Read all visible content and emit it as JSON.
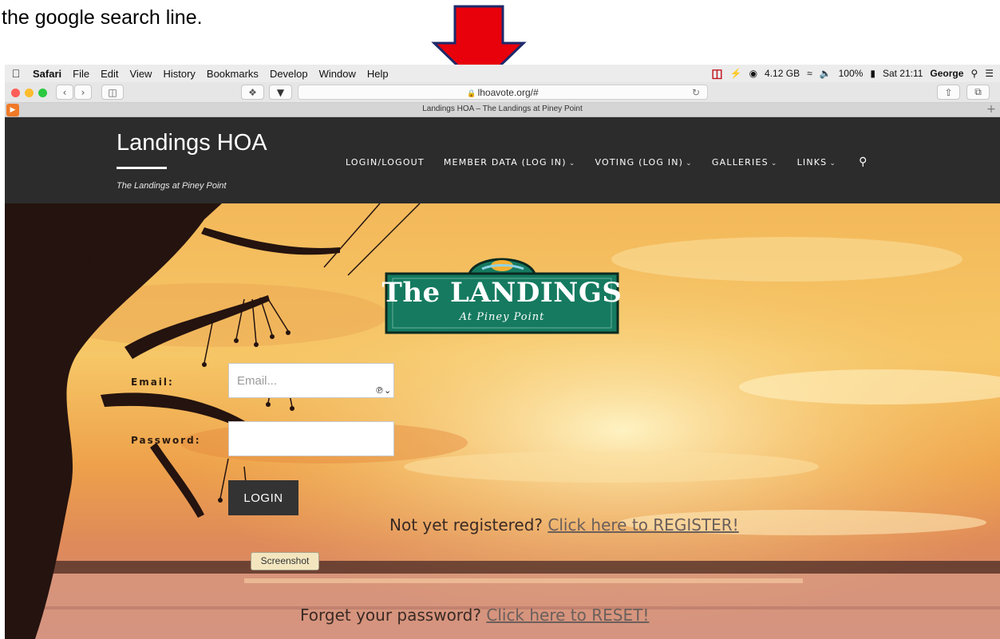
{
  "caption": "the google search line.",
  "menubar": {
    "app": "Safari",
    "items": [
      "File",
      "Edit",
      "View",
      "History",
      "Bookmarks",
      "Develop",
      "Window",
      "Help"
    ],
    "memory": "4.12 GB",
    "battery": "100%",
    "clock": "Sat 21:11",
    "user": "George"
  },
  "browser": {
    "url": "lhoavote.org/#",
    "tab_title": "Landings HOA – The Landings at Piney Point"
  },
  "site": {
    "title": "Landings HOA",
    "tagline": "The Landings at Piney Point",
    "nav": [
      {
        "label": "LOGIN/LOGOUT",
        "has_menu": false
      },
      {
        "label": "MEMBER DATA (LOG IN)",
        "has_menu": true
      },
      {
        "label": "VOTING (LOG IN)",
        "has_menu": true
      },
      {
        "label": "GALLERIES",
        "has_menu": true
      },
      {
        "label": "LINKS",
        "has_menu": true
      }
    ]
  },
  "logo": {
    "title": "The LANDINGS",
    "subtitle": "At Piney Point"
  },
  "login_form": {
    "email_label": "Email:",
    "email_placeholder": "Email...",
    "password_label": "Password:",
    "button": "LOGIN"
  },
  "messages": {
    "register_text": "Not yet registered?",
    "register_link": "Click here to REGISTER!",
    "reset_text": "Forget your password?",
    "reset_link": "Click here to RESET!"
  },
  "tooltip": "Screenshot",
  "colors": {
    "annotation_arrow": "#e8000b",
    "header_bg": "#2c2c2c",
    "logo_green": "#157a60",
    "button_bg": "#333333"
  }
}
